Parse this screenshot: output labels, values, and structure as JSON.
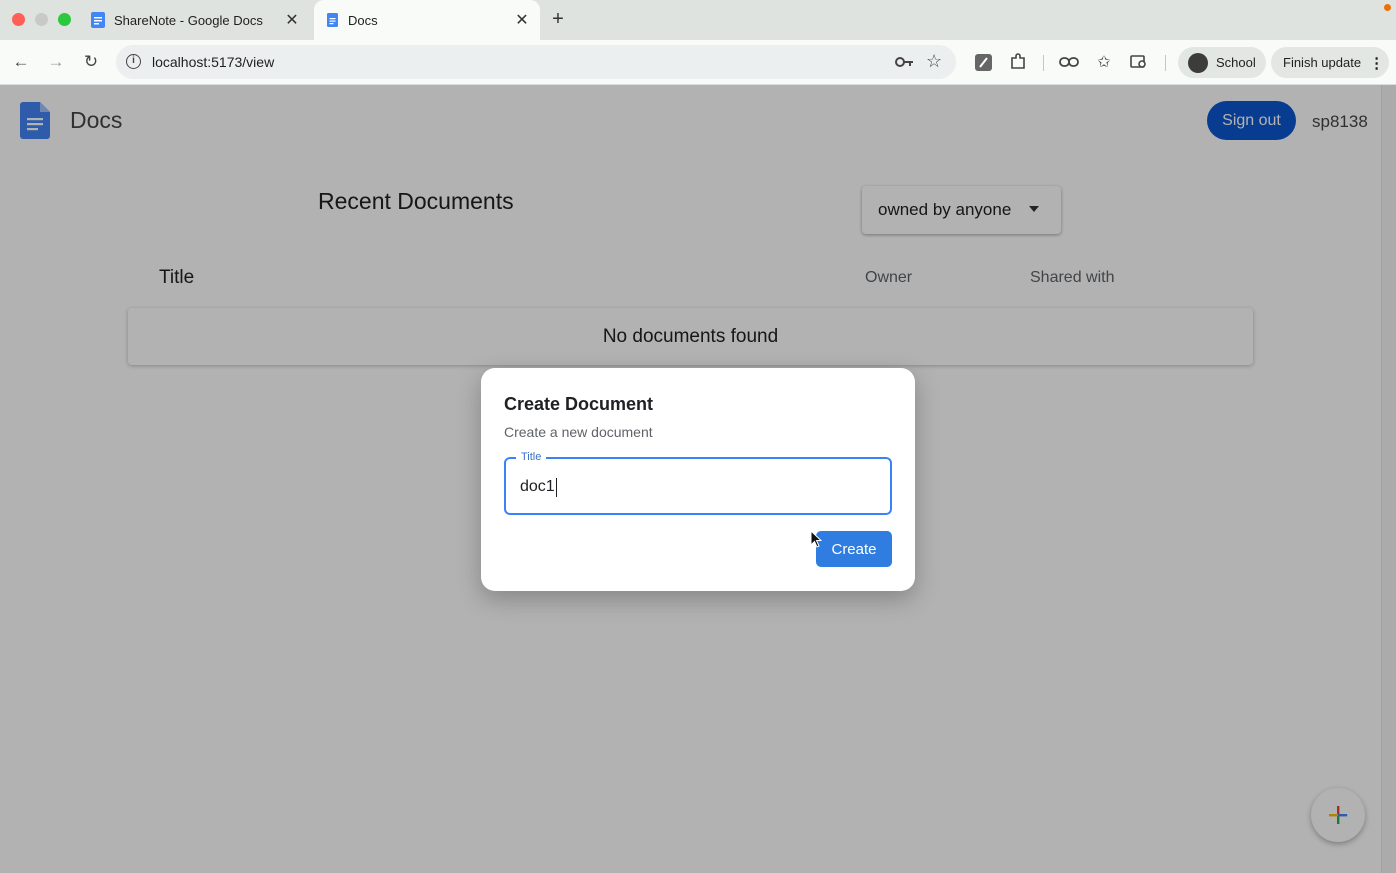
{
  "browser": {
    "tabs": [
      {
        "title": "ShareNote - Google Docs",
        "active": false
      },
      {
        "title": "Docs",
        "active": true
      }
    ],
    "url": "localhost:5173/view",
    "profile_label": "School",
    "update_label": "Finish update"
  },
  "app": {
    "title": "Docs",
    "sign_out_label": "Sign out",
    "username": "sp8138",
    "heading": "Recent Documents",
    "owner_filter": "owned by anyone",
    "columns": {
      "title": "Title",
      "owner": "Owner",
      "shared": "Shared with"
    },
    "empty_message": "No documents found"
  },
  "dialog": {
    "title": "Create Document",
    "subtitle": "Create a new document",
    "field_label": "Title",
    "field_value": "doc1",
    "create_label": "Create"
  },
  "colors": {
    "brand_blue": "#0b57d0",
    "create_blue": "#2f7de1",
    "docs_icon": "#4285f4"
  }
}
